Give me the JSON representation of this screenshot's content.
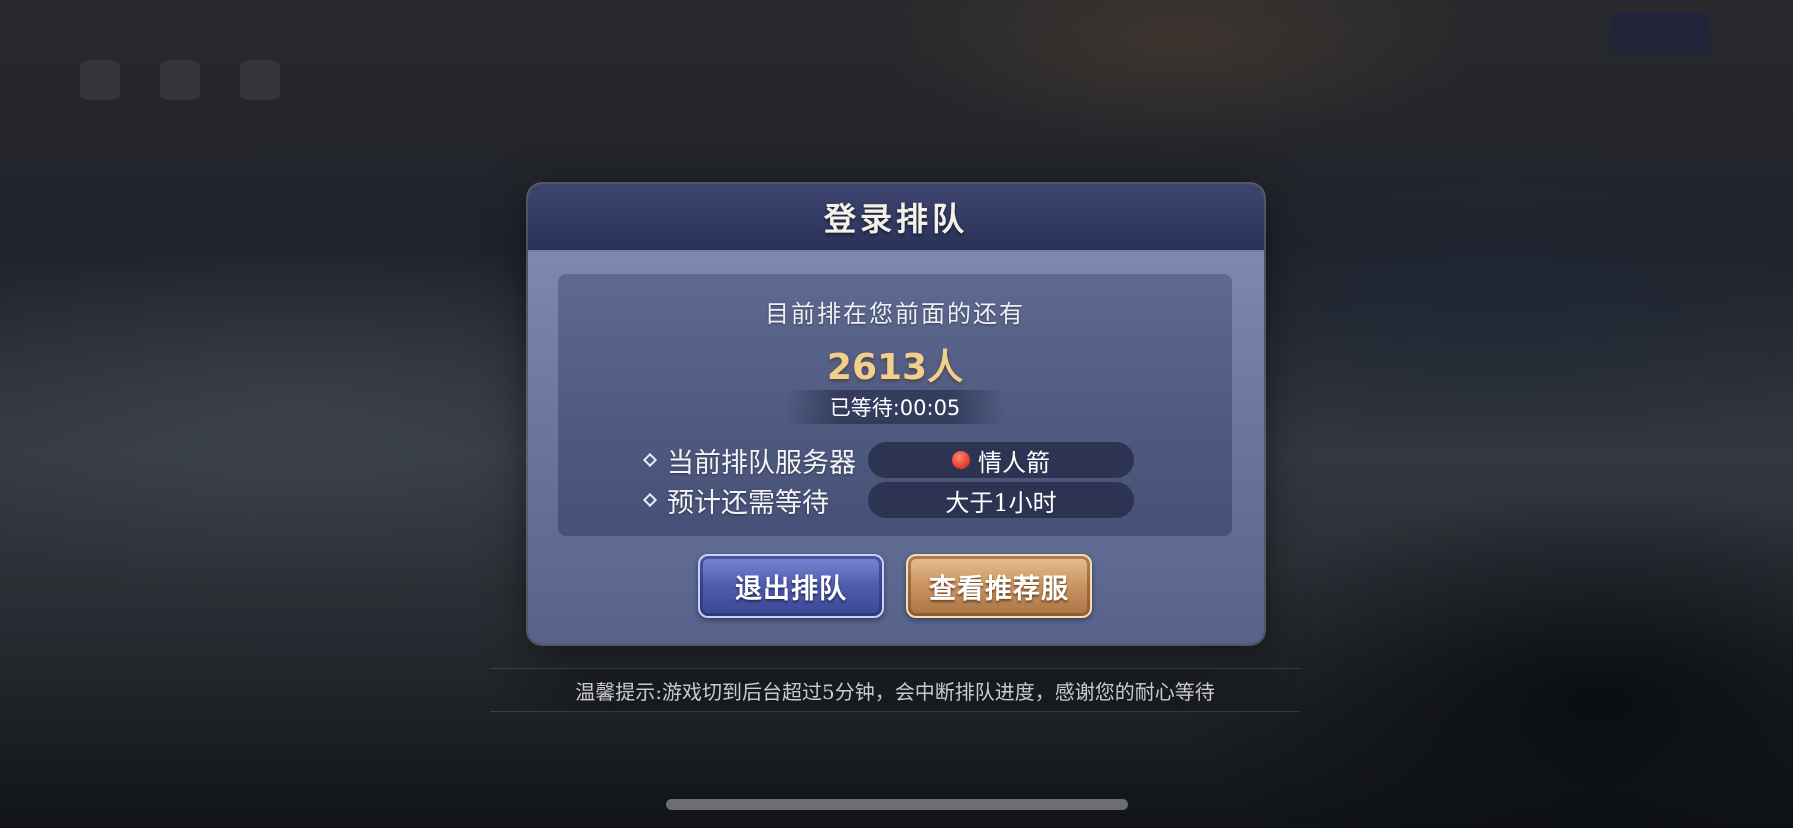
{
  "dialog": {
    "title": "登录排队",
    "queue_label": "目前排在您前面的还有",
    "queue_count": "2613人",
    "waited": "已等待:00:05",
    "rows": [
      {
        "label": "当前排队服务器",
        "value": "情人箭",
        "status_icon": "red-status-dot",
        "status_color": "#e8412c"
      },
      {
        "label": "预计还需等待",
        "value": "大于1小时"
      }
    ],
    "buttons": {
      "exit": "退出排队",
      "recommend": "查看推荐服"
    }
  },
  "tip": "温馨提示:游戏切到后台超过5分钟，会中断排队进度，感谢您的耐心等待",
  "colors": {
    "count_gold": "#f2cf8a",
    "header_navy": "#2b3259",
    "exit_button_blue": "#4e5aac",
    "recommend_button_gold": "#c99362"
  }
}
